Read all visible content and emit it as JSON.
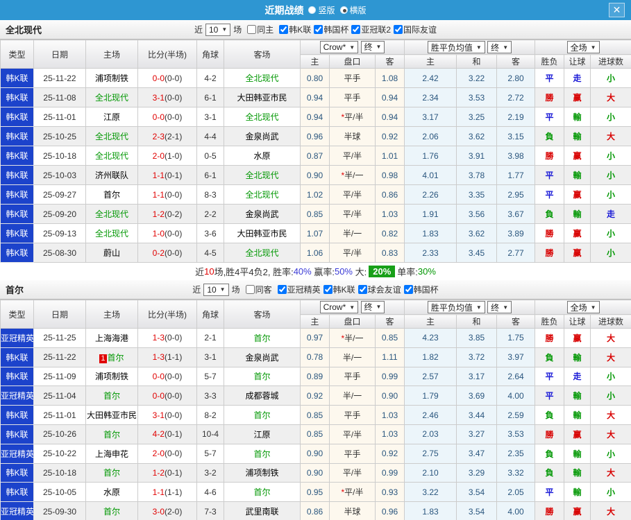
{
  "topbar": {
    "title": "近期战绩",
    "radio_vertical": "竖版",
    "radio_horizontal": "横版",
    "close_icon": "✕"
  },
  "controls": {
    "near": "近",
    "count": "10",
    "games": "场"
  },
  "hdr": {
    "type": "类型",
    "date": "日期",
    "home": "主场",
    "score": "比分(半场)",
    "corner": "角球",
    "away": "客场",
    "crow_select": "Crow*",
    "final_select": "终",
    "avg_select": "胜平负均值",
    "full_select": "全场",
    "h": "主",
    "hcap": "盘口",
    "a": "客",
    "avg_h": "主",
    "avg_d": "和",
    "avg_a": "客",
    "wdl": "胜负",
    "hcap_res": "让球",
    "goals": "进球数"
  },
  "colors": {
    "topbar": "#2e96d2",
    "league_cell": "#1c43cb",
    "win_red": "#d80000",
    "lose_green": "#009702",
    "draw_blue": "#1717d6",
    "crow_bg": "#fdf8ee",
    "avg_bg": "#ecf5fa",
    "badge_green": "#18a018",
    "score_red": "#e00000"
  },
  "sections": [
    {
      "team": "全北现代",
      "same_label": "同主",
      "same_checked": false,
      "leagues": [
        {
          "label": "韩K联",
          "checked": true
        },
        {
          "label": "韩国杯",
          "checked": true
        },
        {
          "label": "亚冠联2",
          "checked": true
        },
        {
          "label": "国际友谊",
          "checked": true
        }
      ],
      "rows": [
        {
          "lg": "韩K联",
          "date": "25-11-22",
          "home": "浦项制铁",
          "score": "0-0",
          "half": "(0-0)",
          "corner": "4-2",
          "away": "全北现代",
          "h1": "0.80",
          "hc": "平手",
          "h2": "1.08",
          "m1": "2.42",
          "m2": "3.22",
          "m3": "2.80",
          "r1": "平",
          "r2": "走",
          "r3": "小"
        },
        {
          "lg": "韩K联",
          "date": "25-11-08",
          "home": "全北现代",
          "score": "3-1",
          "half": "(0-0)",
          "corner": "6-1",
          "away": "大田韩亚市民",
          "h1": "0.94",
          "hc": "平手",
          "h2": "0.94",
          "m1": "2.34",
          "m2": "3.53",
          "m3": "2.72",
          "r1": "勝",
          "r2": "赢",
          "r3": "大"
        },
        {
          "lg": "韩K联",
          "date": "25-11-01",
          "home": "江原",
          "score": "0-0",
          "half": "(0-0)",
          "corner": "3-1",
          "away": "全北现代",
          "h1": "0.94",
          "hc": "*平/半",
          "h2": "0.94",
          "m1": "3.17",
          "m2": "3.25",
          "m3": "2.19",
          "r1": "平",
          "r2": "輸",
          "r3": "小"
        },
        {
          "lg": "韩K联",
          "date": "25-10-25",
          "home": "全北现代",
          "score": "2-3",
          "half": "(2-1)",
          "corner": "4-4",
          "away": "金泉尚武",
          "h1": "0.96",
          "hc": "半球",
          "h2": "0.92",
          "m1": "2.06",
          "m2": "3.62",
          "m3": "3.15",
          "r1": "負",
          "r2": "輸",
          "r3": "大"
        },
        {
          "lg": "韩K联",
          "date": "25-10-18",
          "home": "全北现代",
          "score": "2-0",
          "half": "(1-0)",
          "corner": "0-5",
          "away": "水原",
          "h1": "0.87",
          "hc": "平/半",
          "h2": "1.01",
          "m1": "1.76",
          "m2": "3.91",
          "m3": "3.98",
          "r1": "勝",
          "r2": "赢",
          "r3": "小"
        },
        {
          "lg": "韩K联",
          "date": "25-10-03",
          "home": "济州联队",
          "score": "1-1",
          "half": "(0-1)",
          "corner": "6-1",
          "away": "全北现代",
          "h1": "0.90",
          "hc": "*半/一",
          "h2": "0.98",
          "m1": "4.01",
          "m2": "3.78",
          "m3": "1.77",
          "r1": "平",
          "r2": "輸",
          "r3": "小"
        },
        {
          "lg": "韩K联",
          "date": "25-09-27",
          "home": "首尔",
          "score": "1-1",
          "half": "(0-0)",
          "corner": "8-3",
          "away": "全北现代",
          "h1": "1.02",
          "hc": "平/半",
          "h2": "0.86",
          "m1": "2.26",
          "m2": "3.35",
          "m3": "2.95",
          "r1": "平",
          "r2": "赢",
          "r3": "小"
        },
        {
          "lg": "韩K联",
          "date": "25-09-20",
          "home": "全北现代",
          "score": "1-2",
          "half": "(0-2)",
          "corner": "2-2",
          "away": "金泉尚武",
          "h1": "0.85",
          "hc": "平/半",
          "h2": "1.03",
          "m1": "1.91",
          "m2": "3.56",
          "m3": "3.67",
          "r1": "負",
          "r2": "輸",
          "r3": "走"
        },
        {
          "lg": "韩K联",
          "date": "25-09-13",
          "home": "全北现代",
          "score": "1-0",
          "half": "(0-0)",
          "corner": "3-6",
          "away": "大田韩亚市民",
          "h1": "1.07",
          "hc": "半/一",
          "h2": "0.82",
          "m1": "1.83",
          "m2": "3.62",
          "m3": "3.89",
          "r1": "勝",
          "r2": "赢",
          "r3": "小"
        },
        {
          "lg": "韩K联",
          "date": "25-08-30",
          "home": "蔚山",
          "score": "0-2",
          "half": "(0-0)",
          "corner": "4-5",
          "away": "全北现代",
          "h1": "1.06",
          "hc": "平/半",
          "h2": "0.83",
          "m1": "2.33",
          "m2": "3.45",
          "m3": "2.77",
          "r1": "勝",
          "r2": "赢",
          "r3": "小"
        }
      ],
      "summary": [
        {
          "t": "近",
          "c": "plain"
        },
        {
          "t": "10",
          "c": "red"
        },
        {
          "t": "场,胜4平4负2, 胜率:",
          "c": "plain"
        },
        {
          "t": "40%",
          "c": "blue"
        },
        {
          "t": " 赢率:",
          "c": "plain"
        },
        {
          "t": "50%",
          "c": "blue"
        },
        {
          "t": " 大:",
          "c": "plain"
        },
        {
          "t": "20%",
          "c": "badge"
        },
        {
          "t": "单率:",
          "c": "plain"
        },
        {
          "t": "30%",
          "c": "green"
        }
      ]
    },
    {
      "team": "首尔",
      "same_label": "同客",
      "same_checked": false,
      "leagues": [
        {
          "label": "亚冠精英",
          "checked": true
        },
        {
          "label": "韩K联",
          "checked": true
        },
        {
          "label": "球会友谊",
          "checked": true
        },
        {
          "label": "韩国杯",
          "checked": true
        }
      ],
      "rows": [
        {
          "lg": "亚冠精英",
          "date": "25-11-25",
          "home": "上海海港",
          "score": "1-3",
          "half": "(0-0)",
          "corner": "2-1",
          "away": "首尔",
          "h1": "0.97",
          "hc": "*半/一",
          "h2": "0.85",
          "m1": "4.23",
          "m2": "3.85",
          "m3": "1.75",
          "r1": "勝",
          "r2": "赢",
          "r3": "大"
        },
        {
          "lg": "韩K联",
          "date": "25-11-22",
          "home": "首尔",
          "homeBadge": "1",
          "score": "1-3",
          "half": "(1-1)",
          "corner": "3-1",
          "away": "金泉尚武",
          "h1": "0.78",
          "hc": "半/一",
          "h2": "1.11",
          "m1": "1.82",
          "m2": "3.72",
          "m3": "3.97",
          "r1": "負",
          "r2": "輸",
          "r3": "大"
        },
        {
          "lg": "韩K联",
          "date": "25-11-09",
          "home": "浦项制铁",
          "score": "0-0",
          "half": "(0-0)",
          "corner": "5-7",
          "away": "首尔",
          "h1": "0.89",
          "hc": "平手",
          "h2": "0.99",
          "m1": "2.57",
          "m2": "3.17",
          "m3": "2.64",
          "r1": "平",
          "r2": "走",
          "r3": "小"
        },
        {
          "lg": "亚冠精英",
          "date": "25-11-04",
          "home": "首尔",
          "score": "0-0",
          "half": "(0-0)",
          "corner": "3-3",
          "away": "成都蓉城",
          "h1": "0.92",
          "hc": "半/一",
          "h2": "0.90",
          "m1": "1.79",
          "m2": "3.69",
          "m3": "4.00",
          "r1": "平",
          "r2": "輸",
          "r3": "小"
        },
        {
          "lg": "韩K联",
          "date": "25-11-01",
          "home": "大田韩亚市民",
          "score": "3-1",
          "half": "(0-0)",
          "corner": "8-2",
          "away": "首尔",
          "h1": "0.85",
          "hc": "平手",
          "h2": "1.03",
          "m1": "2.46",
          "m2": "3.44",
          "m3": "2.59",
          "r1": "負",
          "r2": "輸",
          "r3": "大"
        },
        {
          "lg": "韩K联",
          "date": "25-10-26",
          "home": "首尔",
          "score": "4-2",
          "half": "(0-1)",
          "corner": "10-4",
          "away": "江原",
          "h1": "0.85",
          "hc": "平/半",
          "h2": "1.03",
          "m1": "2.03",
          "m2": "3.27",
          "m3": "3.53",
          "r1": "勝",
          "r2": "赢",
          "r3": "大"
        },
        {
          "lg": "亚冠精英",
          "date": "25-10-22",
          "home": "上海申花",
          "score": "2-0",
          "half": "(0-0)",
          "corner": "5-7",
          "away": "首尔",
          "h1": "0.90",
          "hc": "平手",
          "h2": "0.92",
          "m1": "2.75",
          "m2": "3.47",
          "m3": "2.35",
          "r1": "負",
          "r2": "輸",
          "r3": "小"
        },
        {
          "lg": "韩K联",
          "date": "25-10-18",
          "home": "首尔",
          "score": "1-2",
          "half": "(0-1)",
          "corner": "3-2",
          "away": "浦项制铁",
          "h1": "0.90",
          "hc": "平/半",
          "h2": "0.99",
          "m1": "2.10",
          "m2": "3.29",
          "m3": "3.32",
          "r1": "負",
          "r2": "輸",
          "r3": "大"
        },
        {
          "lg": "韩K联",
          "date": "25-10-05",
          "home": "水原",
          "score": "1-1",
          "half": "(1-1)",
          "corner": "4-6",
          "away": "首尔",
          "h1": "0.95",
          "hc": "*平/半",
          "h2": "0.93",
          "m1": "3.22",
          "m2": "3.54",
          "m3": "2.05",
          "r1": "平",
          "r2": "輸",
          "r3": "小"
        },
        {
          "lg": "亚冠精英",
          "date": "25-09-30",
          "home": "首尔",
          "score": "3-0",
          "half": "(2-0)",
          "corner": "7-3",
          "away": "武里南联",
          "h1": "0.86",
          "hc": "半球",
          "h2": "0.96",
          "m1": "1.83",
          "m2": "3.54",
          "m3": "4.00",
          "r1": "勝",
          "r2": "赢",
          "r3": "大"
        }
      ],
      "summary": []
    }
  ]
}
